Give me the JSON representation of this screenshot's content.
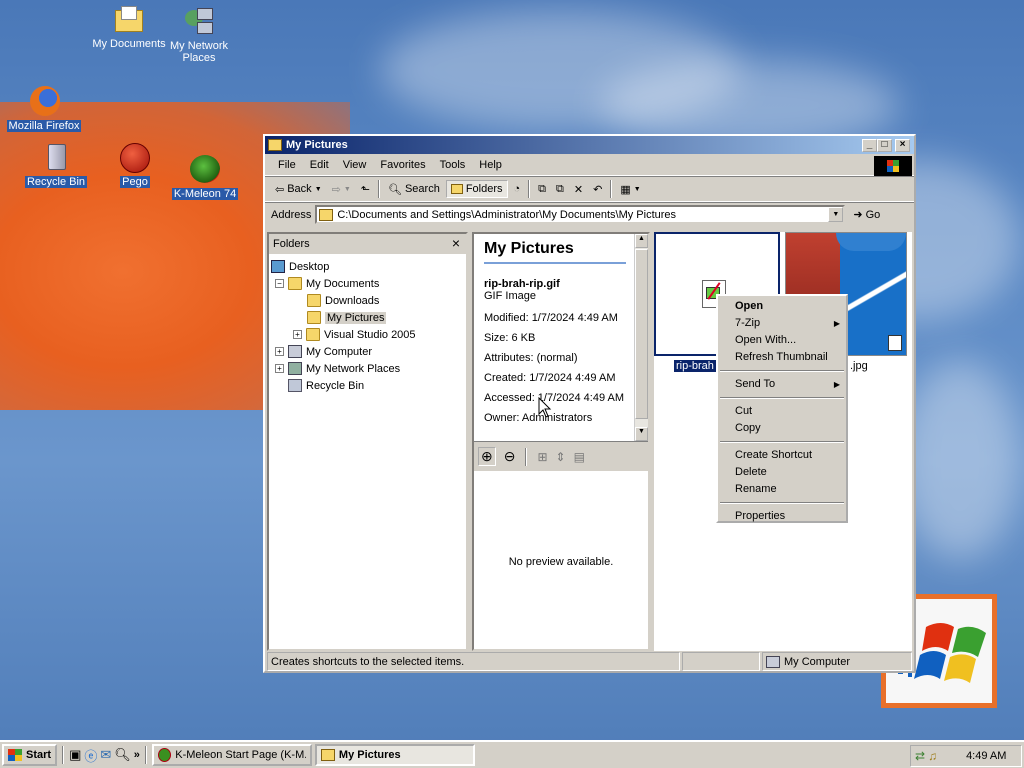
{
  "desktop": {
    "icons": [
      {
        "label": "My Documents"
      },
      {
        "label": "My Network Places"
      },
      {
        "label": "Mozilla Firefox"
      },
      {
        "label": "Recycle Bin"
      },
      {
        "label": "Pego"
      },
      {
        "label": "K-Meleon 74"
      }
    ]
  },
  "window": {
    "title": "My Pictures",
    "menu": [
      "File",
      "Edit",
      "View",
      "Favorites",
      "Tools",
      "Help"
    ],
    "toolbar": {
      "back": "Back",
      "search": "Search",
      "folders": "Folders"
    },
    "address": {
      "label": "Address",
      "value": "C:\\Documents and Settings\\Administrator\\My Documents\\My Pictures",
      "go": "Go"
    },
    "folders_pane": {
      "title": "Folders",
      "close": "×",
      "tree": [
        {
          "label": "Desktop"
        },
        {
          "label": "My Documents"
        },
        {
          "label": "Downloads"
        },
        {
          "label": "My Pictures"
        },
        {
          "label": "Visual Studio 2005"
        },
        {
          "label": "My Computer"
        },
        {
          "label": "My Network Places"
        },
        {
          "label": "Recycle Bin"
        }
      ]
    },
    "info": {
      "heading": "My Pictures",
      "filename": "rip-brah-rip.gif",
      "filetype": "GIF Image",
      "modified": "Modified: 1/7/2024 4:49 AM",
      "size": "Size: 6 KB",
      "attributes": "Attributes: (normal)",
      "created": "Created: 1/7/2024 4:49 AM",
      "accessed": "Accessed: 1/7/2024 4:49 AM",
      "owner": "Owner: Administrators",
      "preview": "No preview available."
    },
    "files": [
      {
        "label": "rip-brah"
      },
      {
        "label": ".jpg"
      }
    ],
    "status": {
      "text": "Creates shortcuts to the selected items.",
      "zone": "My Computer"
    }
  },
  "context_menu": {
    "items": [
      {
        "label": "Open"
      },
      {
        "label": "7-Zip"
      },
      {
        "label": "Open With..."
      },
      {
        "label": "Refresh Thumbnail"
      },
      {
        "label": "Send To"
      },
      {
        "label": "Cut"
      },
      {
        "label": "Copy"
      },
      {
        "label": "Create Shortcut"
      },
      {
        "label": "Delete"
      },
      {
        "label": "Rename"
      },
      {
        "label": "Properties"
      }
    ]
  },
  "taskbar": {
    "start": "Start",
    "chevron": "»",
    "buttons": [
      {
        "label": "K-Meleon Start Page (K-M..."
      },
      {
        "label": "My Pictures"
      }
    ],
    "clock": "4:49 AM"
  }
}
